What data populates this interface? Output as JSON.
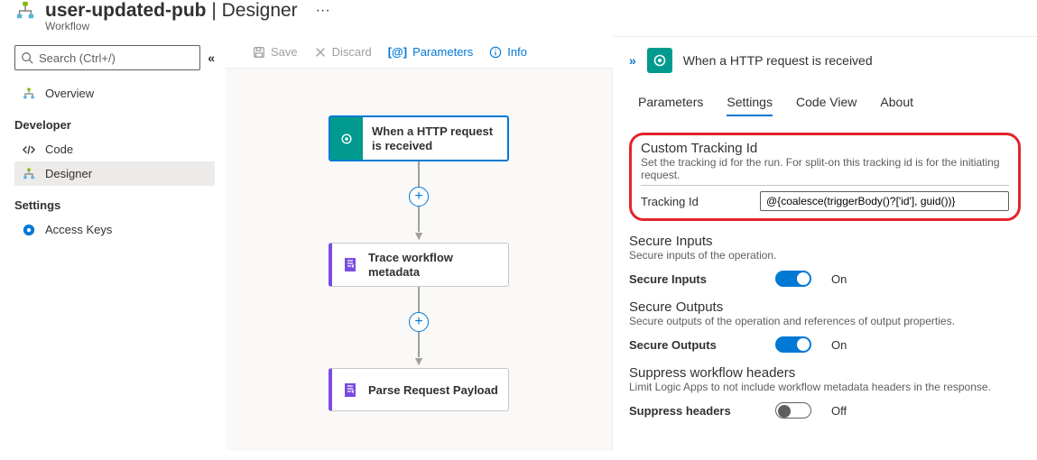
{
  "header": {
    "title_bold": "user-updated-pub",
    "title_sep": " | ",
    "title_light": "Designer",
    "subtitle": "Workflow"
  },
  "search": {
    "placeholder": "Search (Ctrl+/)"
  },
  "sidebar": {
    "overview": "Overview",
    "groups": {
      "developer": "Developer",
      "settings": "Settings"
    },
    "code": "Code",
    "designer": "Designer",
    "access_keys": "Access Keys"
  },
  "toolbar": {
    "save": "Save",
    "discard": "Discard",
    "parameters": "Parameters",
    "info": "Info"
  },
  "flow": {
    "trigger": "When a HTTP request is received",
    "step_trace": "Trace workflow metadata",
    "step_parse": "Parse Request Payload"
  },
  "detail": {
    "title": "When a HTTP request is received",
    "tabs": {
      "parameters": "Parameters",
      "settings": "Settings",
      "code_view": "Code View",
      "about": "About"
    },
    "custom_tracking": {
      "title": "Custom Tracking Id",
      "sub": "Set the tracking id for the run. For split-on this tracking id is for the initiating request.",
      "label": "Tracking Id",
      "value": "@{coalesce(triggerBody()?['id'], guid())}"
    },
    "secure_inputs": {
      "title": "Secure Inputs",
      "sub": "Secure inputs of the operation.",
      "label": "Secure Inputs",
      "state": "On"
    },
    "secure_outputs": {
      "title": "Secure Outputs",
      "sub": "Secure outputs of the operation and references of output properties.",
      "label": "Secure Outputs",
      "state": "On"
    },
    "suppress": {
      "title": "Suppress workflow headers",
      "sub": "Limit Logic Apps to not include workflow metadata headers in the response.",
      "label": "Suppress headers",
      "state": "Off"
    }
  }
}
